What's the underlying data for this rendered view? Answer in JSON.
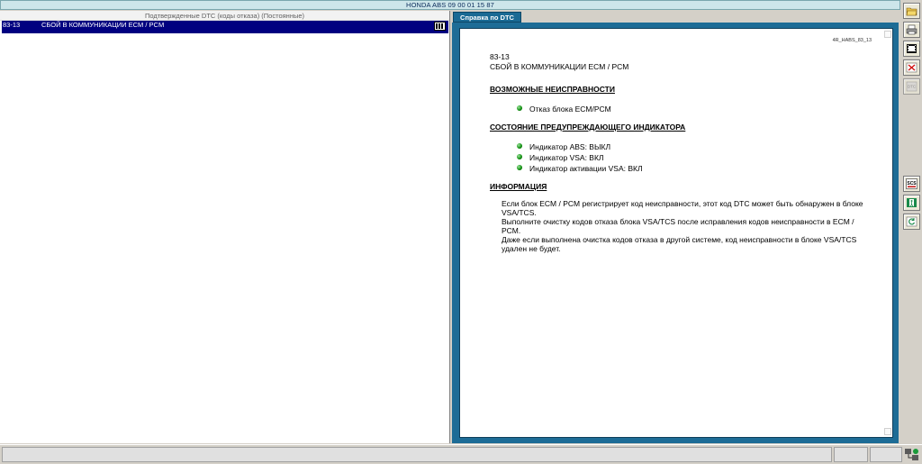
{
  "window": {
    "title": "HONDA ABS  09 00 01 15 87"
  },
  "left_panel": {
    "header": "Подтвержденные DTC (коды отказа) (Постоянные)",
    "rows": [
      {
        "code": "83-13",
        "description": "СБОЙ В КОММУНИКАЦИИ ECM / PCM",
        "icon": "film-icon"
      }
    ]
  },
  "right_panel": {
    "tab_label": "Справка по DTC",
    "doc": {
      "ref": "4R_HABS_83_13",
      "code": "83-13",
      "title": "СБОЙ В КОММУНИКАЦИИ ECM / PCM",
      "sections": [
        {
          "heading": "ВОЗМОЖНЫЕ НЕИСПРАВНОСТИ",
          "bullets": [
            "Отказ блока ECM/PCM"
          ]
        },
        {
          "heading": "СОСТОЯНИЕ ПРЕДУПРЕЖДАЮЩЕГО ИНДИКАТОРА",
          "bullets": [
            "Индикатор ABS: ВЫКЛ",
            "Индикатор VSA: ВКЛ",
            "Индикатор активации VSA: ВКЛ"
          ]
        },
        {
          "heading": "ИНФОРМАЦИЯ",
          "lines": [
            "Если блок ECM / PCM регистрирует код неисправности, этот код DTC может быть обнаружен в блоке",
            "VSA/TCS.",
            "Выполните очистку кодов отказа блока VSA/TCS после исправления кодов неисправности в ECM /",
            "PCM.",
            "Даже если выполнена очистка кодов отказа в другой системе, код неисправности в блоке VSA/TCS",
            "удален не будет."
          ]
        }
      ]
    }
  },
  "toolbar": {
    "buttons": [
      {
        "name": "open-folder-icon",
        "label": ""
      },
      {
        "name": "print-icon",
        "label": ""
      },
      {
        "name": "film-icon",
        "label": ""
      },
      {
        "name": "dtc-clear-icon",
        "label": ""
      },
      {
        "name": "dtc-icon",
        "label": "DTC"
      },
      {
        "name": "scs-icon",
        "label": "SCS"
      },
      {
        "name": "exit-icon",
        "label": ""
      },
      {
        "name": "refresh-icon",
        "label": ""
      }
    ]
  },
  "status_bar": {
    "main": "",
    "cell_a": "",
    "cell_b": "",
    "icon": "connection-icon"
  },
  "colors": {
    "selection": "#000080",
    "frame": "#1d6c96",
    "bullet": "#0a8a0a"
  }
}
